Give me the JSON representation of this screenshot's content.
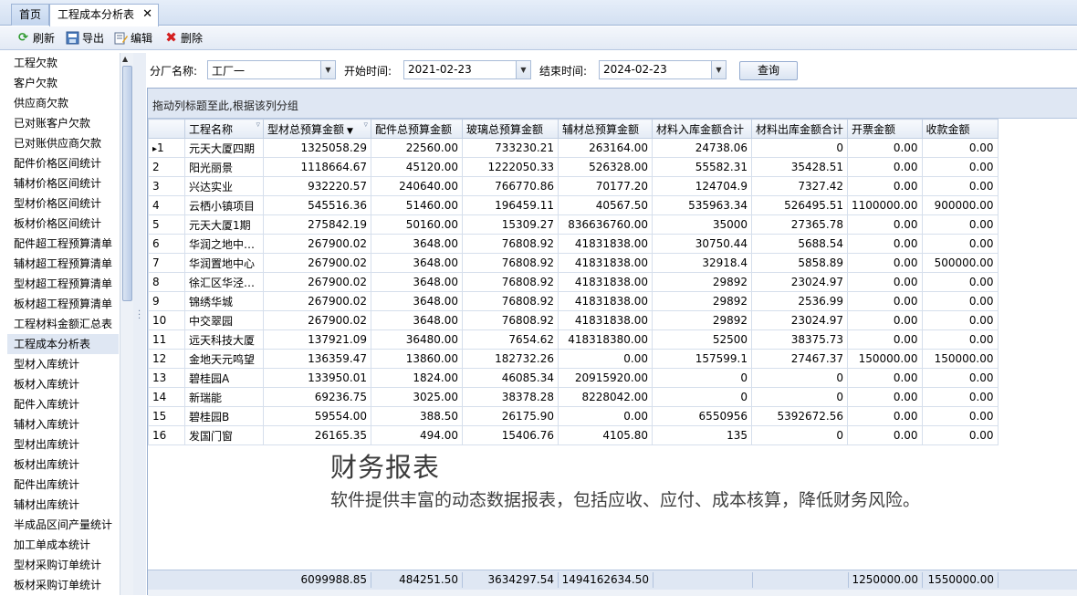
{
  "tabs": [
    {
      "label": "首页"
    },
    {
      "label": "工程成本分析表",
      "close": "✕"
    }
  ],
  "toolbar": {
    "refresh": "刷新",
    "export": "导出",
    "edit": "编辑",
    "delete": "删除"
  },
  "nav": {
    "items": [
      "工程欠款",
      "客户欠款",
      "供应商欠款",
      "已对账客户欠款",
      "已对账供应商欠款",
      "配件价格区间统计",
      "辅材价格区间统计",
      "型材价格区间统计",
      "板材价格区间统计",
      "配件超工程预算清单",
      "辅材超工程预算清单",
      "型材超工程预算清单",
      "板材超工程预算清单",
      "工程材料金额汇总表",
      "工程成本分析表",
      "型材入库统计",
      "板材入库统计",
      "配件入库统计",
      "辅材入库统计",
      "型材出库统计",
      "板材出库统计",
      "配件出库统计",
      "辅材出库统计",
      "半成品区间产量统计",
      "加工单成本统计",
      "型材采购订单统计",
      "板材采购订单统计"
    ],
    "selected_index": 14
  },
  "filters": {
    "factory_label": "分厂名称:",
    "factory_value": "工厂一",
    "start_label": "开始时间:",
    "start_value": "2021-02-23",
    "end_label": "结束时间:",
    "end_value": "2024-02-23",
    "query_button": "查询"
  },
  "grid": {
    "group_hint": "拖动列标题至此,根据该列分组",
    "columns": [
      "工程名称",
      "型材总预算金额",
      "配件总预算金额",
      "玻璃总预算金额",
      "辅材总预算金额",
      "材料入库金额合计",
      "材料出库金额合计",
      "开票金额",
      "收款金额"
    ],
    "rows": [
      [
        "1",
        "元天大厦四期",
        "1325058.29",
        "22560.00",
        "733230.21",
        "263164.00",
        "24738.06",
        "0",
        "0.00",
        "0.00"
      ],
      [
        "2",
        "阳光丽景",
        "1118664.67",
        "45120.00",
        "1222050.33",
        "526328.00",
        "55582.31",
        "35428.51",
        "0.00",
        "0.00"
      ],
      [
        "3",
        "兴达实业",
        "932220.57",
        "240640.00",
        "766770.86",
        "70177.20",
        "124704.9",
        "7327.42",
        "0.00",
        "0.00"
      ],
      [
        "4",
        "云栖小镇项目",
        "545516.36",
        "51460.00",
        "196459.11",
        "40567.50",
        "535963.34",
        "526495.51",
        "1100000.00",
        "900000.00"
      ],
      [
        "5",
        "元天大厦1期",
        "275842.19",
        "50160.00",
        "15309.27",
        "836636760.00",
        "35000",
        "27365.78",
        "0.00",
        "0.00"
      ],
      [
        "6",
        "华润之地中…",
        "267900.02",
        "3648.00",
        "76808.92",
        "41831838.00",
        "30750.44",
        "5688.54",
        "0.00",
        "0.00"
      ],
      [
        "7",
        "华润置地中心",
        "267900.02",
        "3648.00",
        "76808.92",
        "41831838.00",
        "32918.4",
        "5858.89",
        "0.00",
        "500000.00"
      ],
      [
        "8",
        "徐汇区华泾…",
        "267900.02",
        "3648.00",
        "76808.92",
        "41831838.00",
        "29892",
        "23024.97",
        "0.00",
        "0.00"
      ],
      [
        "9",
        "锦绣华城",
        "267900.02",
        "3648.00",
        "76808.92",
        "41831838.00",
        "29892",
        "2536.99",
        "0.00",
        "0.00"
      ],
      [
        "10",
        "中交翠园",
        "267900.02",
        "3648.00",
        "76808.92",
        "41831838.00",
        "29892",
        "23024.97",
        "0.00",
        "0.00"
      ],
      [
        "11",
        "远天科技大厦",
        "137921.09",
        "36480.00",
        "7654.62",
        "418318380.00",
        "52500",
        "38375.73",
        "0.00",
        "0.00"
      ],
      [
        "12",
        "金地天元鸣望",
        "136359.47",
        "13860.00",
        "182732.26",
        "0.00",
        "157599.1",
        "27467.37",
        "150000.00",
        "150000.00"
      ],
      [
        "13",
        "碧桂园A",
        "133950.01",
        "1824.00",
        "46085.34",
        "20915920.00",
        "0",
        "0",
        "0.00",
        "0.00"
      ],
      [
        "14",
        "新瑞能",
        "69236.75",
        "3025.00",
        "38378.28",
        "8228042.00",
        "0",
        "0",
        "0.00",
        "0.00"
      ],
      [
        "15",
        "碧桂园B",
        "59554.00",
        "388.50",
        "26175.90",
        "0.00",
        "6550956",
        "5392672.56",
        "0.00",
        "0.00"
      ],
      [
        "16",
        "发国门窗",
        "26165.35",
        "494.00",
        "15406.76",
        "4105.80",
        "135",
        "0",
        "0.00",
        "0.00"
      ]
    ],
    "totals": {
      "profile_budget": "6099988.85",
      "fitting_budget": "484251.50",
      "glass_budget": "3634297.54",
      "aux_budget": "1494162634.50",
      "invoice": "1250000.00",
      "received": "1550000.00"
    }
  },
  "promo": {
    "title": "财务报表",
    "subtitle": "软件提供丰富的动态数据报表，包括应收、应付、成本核算，降低财务风险。"
  },
  "colors": {
    "tab_bg": "#d3e0f2",
    "grid_border": "#d6dfec",
    "group_panel": "#dfe7f3",
    "delete_icon": "#d42020",
    "refresh_icon": "#2e9a2e"
  }
}
